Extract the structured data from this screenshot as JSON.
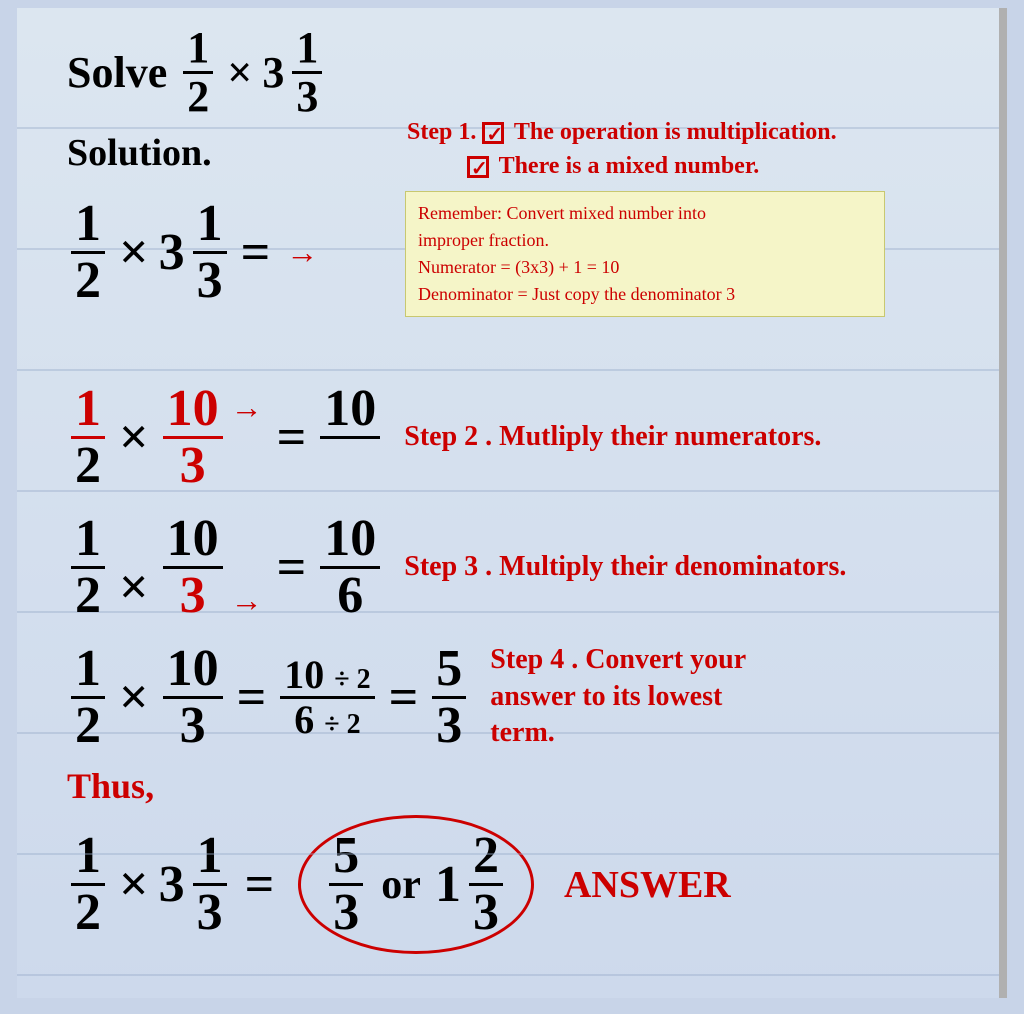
{
  "title": {
    "solve_label": "Solve",
    "fraction1_num": "1",
    "fraction1_den": "2",
    "times": "×",
    "whole": "3",
    "fraction2_num": "1",
    "fraction2_den": "3"
  },
  "solution": {
    "label": "Solution."
  },
  "step1": {
    "label": "Step 1.",
    "line1": "The operation is multiplication.",
    "line2": "There is a mixed number."
  },
  "info_box": {
    "line1": "Remember: Convert mixed number into",
    "line2": "improper fraction.",
    "line3": "Numerator = (3x3) + 1 = 10",
    "line4": "Denominator = Just copy the denominator 3"
  },
  "step2": {
    "label": "Step 2 . Mutliply their numerators.",
    "f1_num": "1",
    "f1_den": "2",
    "f2_num": "10",
    "f2_den": "3",
    "result_num": "10"
  },
  "step3": {
    "label": "Step 3 . Multiply their denominators.",
    "f1_num": "1",
    "f1_den": "2",
    "f2_num": "10",
    "f2_den": "3",
    "result_num": "10",
    "result_den": "6"
  },
  "step4": {
    "label": "Step 4 . Convert your answer to its lowest term.",
    "f1_num": "1",
    "f1_den": "2",
    "f2_num": "10",
    "f2_den": "3",
    "frac1_num": "10",
    "frac1_den": "6",
    "div_num": "÷ 2",
    "div_den": "÷ 2",
    "result_num": "5",
    "result_den": "3"
  },
  "thus": {
    "label": "Thus,"
  },
  "final": {
    "f1_num": "1",
    "f1_den": "2",
    "whole": "3",
    "f2_num": "1",
    "f2_den": "3",
    "equals": "=",
    "ans_frac_num": "5",
    "ans_frac_den": "3",
    "or": "or",
    "ans_mixed_whole": "1",
    "ans_mixed_num": "2",
    "ans_mixed_den": "3",
    "answer_label": "ANSWER"
  }
}
